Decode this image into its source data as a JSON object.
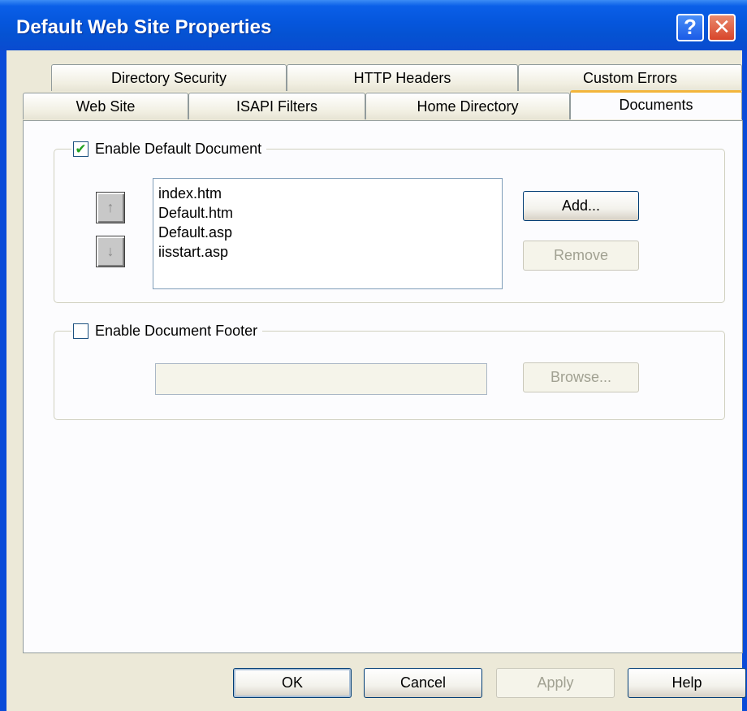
{
  "window": {
    "title": "Default Web Site Properties",
    "help_glyph": "?",
    "close_glyph": "✕"
  },
  "tabs_back_row": [
    "Directory Security",
    "HTTP Headers",
    "Custom Errors"
  ],
  "tabs_front_row": [
    "Web Site",
    "ISAPI Filters",
    "Home Directory",
    "Documents"
  ],
  "active_tab": "Documents",
  "default_document": {
    "label": "Enable Default Document",
    "checked": true,
    "check_glyph": "✔",
    "move_up_glyph": "↑",
    "move_down_glyph": "↓",
    "documents": [
      "index.htm",
      "Default.htm",
      "Default.asp",
      "iisstart.asp"
    ],
    "add_label": "Add...",
    "remove_label": "Remove"
  },
  "document_footer": {
    "label": "Enable Document Footer",
    "checked": false,
    "path_value": "",
    "browse_label": "Browse..."
  },
  "dialog_buttons": {
    "ok": "OK",
    "cancel": "Cancel",
    "apply": "Apply",
    "help": "Help"
  },
  "colors": {
    "titlebar": "#0556dc",
    "dialog_bg": "#ece9d8",
    "active_tab_accent": "#f3b53b",
    "check_mark": "#21a121"
  }
}
